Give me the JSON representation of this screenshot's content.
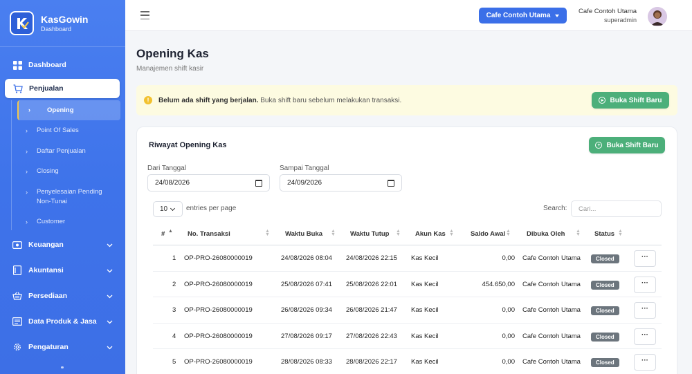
{
  "brand": {
    "name": "KasGowin",
    "sub": "Dashboard"
  },
  "sidebar": {
    "items": [
      {
        "label": "Dashboard",
        "icon": "grid-icon"
      },
      {
        "label": "Penjualan",
        "icon": "cart-icon"
      },
      {
        "label": "Keuangan",
        "icon": "money-icon"
      },
      {
        "label": "Akuntansi",
        "icon": "book-icon"
      },
      {
        "label": "Persediaan",
        "icon": "basket-icon"
      },
      {
        "label": "Data Produk & Jasa",
        "icon": "list-icon"
      },
      {
        "label": "Pengaturan",
        "icon": "gear-icon"
      }
    ],
    "subitems": [
      {
        "label": "Opening"
      },
      {
        "label": "Point Of Sales"
      },
      {
        "label": "Daftar Penjualan"
      },
      {
        "label": "Closing"
      },
      {
        "label": "Penyelesaian Pending"
      },
      {
        "label": "Non-Tunai"
      },
      {
        "label": "Customer"
      }
    ]
  },
  "topbar": {
    "cafe_select": "Cafe Contoh Utama",
    "user_name": "Cafe Contoh Utama",
    "user_role": "superadmin"
  },
  "page": {
    "title": "Opening Kas",
    "subtitle": "Manajemen shift kasir"
  },
  "alert": {
    "strong": "Belum ada shift yang berjalan.",
    "text": " Buka shift baru sebelum melakukan transaksi.",
    "button": "Buka Shift Baru"
  },
  "card": {
    "title": "Riwayat Opening Kas",
    "button": "Buka Shift Baru",
    "from_label": "Dari Tanggal",
    "from_value": "24/08/2026",
    "to_label": "Sampai Tanggal",
    "to_value": "24/09/2026",
    "page_length": "10",
    "entries_text": "entries per page",
    "search_label": "Search:",
    "search_placeholder": "Cari..."
  },
  "table": {
    "headers": [
      "#",
      "No. Transaksi",
      "Waktu Buka",
      "Waktu Tutup",
      "Akun Kas",
      "Saldo Awal",
      "Dibuka Oleh",
      "Status"
    ],
    "rows": [
      {
        "no": "1",
        "trx": "OP-PRO-26080000019",
        "buka": "24/08/2026 08:04",
        "tutup": "24/08/2026 22:15",
        "akun": "Kas Kecil",
        "saldo": "0,00",
        "oleh": "Cafe Contoh Utama",
        "status": "Closed",
        "action": "···"
      },
      {
        "no": "2",
        "trx": "OP-PRO-26080000019",
        "buka": "25/08/2026 07:41",
        "tutup": "25/08/2026 22:01",
        "akun": "Kas Kecil",
        "saldo": "454.650,00",
        "oleh": "Cafe Contoh Utama",
        "status": "Closed",
        "action": "···"
      },
      {
        "no": "3",
        "trx": "OP-PRO-26080000019",
        "buka": "26/08/2026 09:34",
        "tutup": "26/08/2026 21:47",
        "akun": "Kas Kecil",
        "saldo": "0,00",
        "oleh": "Cafe Contoh Utama",
        "status": "Closed",
        "action": "···"
      },
      {
        "no": "4",
        "trx": "OP-PRO-26080000019",
        "buka": "27/08/2026 09:17",
        "tutup": "27/08/2026 22:43",
        "akun": "Kas Kecil",
        "saldo": "0,00",
        "oleh": "Cafe Contoh Utama",
        "status": "Closed",
        "action": "···"
      },
      {
        "no": "5",
        "trx": "OP-PRO-26080000019",
        "buka": "28/08/2026 08:33",
        "tutup": "28/08/2026 22:17",
        "akun": "Kas Kecil",
        "saldo": "0,00",
        "oleh": "Cafe Contoh Utama",
        "status": "Closed",
        "action": "···"
      }
    ]
  },
  "colors": {
    "primary": "#3b6fe8",
    "success": "#4caf7a",
    "badge": "#6c757d",
    "alert_bg": "#fdfbe1"
  }
}
